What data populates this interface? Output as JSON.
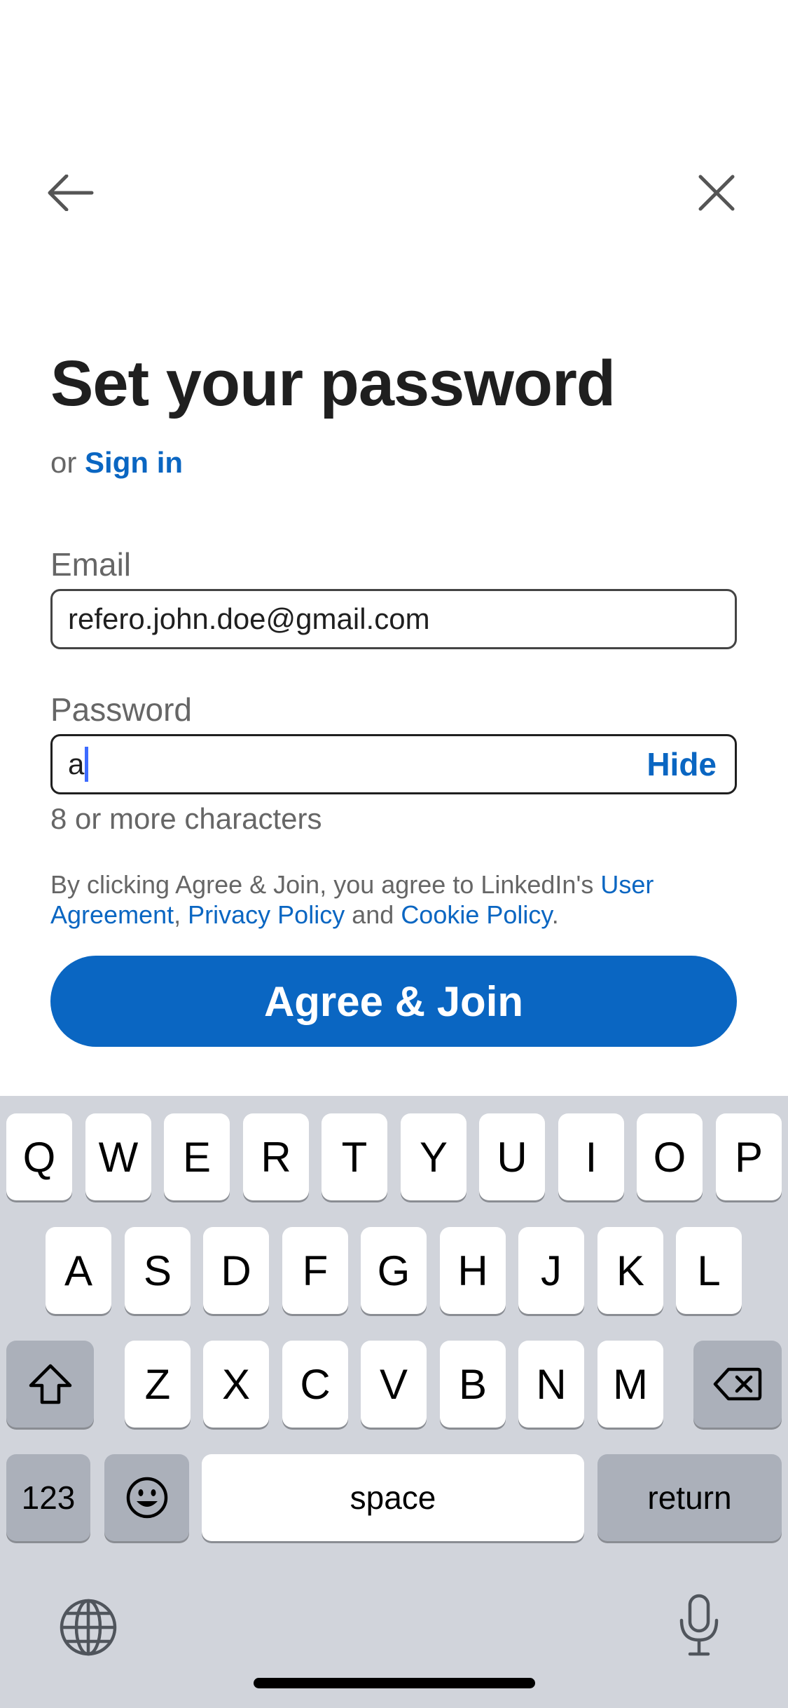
{
  "header": {
    "back_icon": "arrow-left-icon",
    "close_icon": "close-icon"
  },
  "title": "Set your password",
  "signin": {
    "prefix": "or",
    "link": "Sign in"
  },
  "email": {
    "label": "Email",
    "value": "refero.john.doe@gmail.com"
  },
  "password": {
    "label": "Password",
    "value": "a",
    "toggle": "Hide",
    "hint": "8 or more characters"
  },
  "legal": {
    "text1": "By clicking Agree & Join, you agree to LinkedIn's",
    "user_agreement": "User Agreement",
    "comma": ",",
    "privacy_policy": "Privacy Policy",
    "and": "and",
    "cookie_policy": "Cookie Policy",
    "period": "."
  },
  "cta": {
    "label": "Agree & Join"
  },
  "keyboard": {
    "row1": [
      "Q",
      "W",
      "E",
      "R",
      "T",
      "Y",
      "U",
      "I",
      "O",
      "P"
    ],
    "row2": [
      "A",
      "S",
      "D",
      "F",
      "G",
      "H",
      "J",
      "K",
      "L"
    ],
    "row3": [
      "Z",
      "X",
      "C",
      "V",
      "B",
      "N",
      "M"
    ],
    "numbers": "123",
    "space": "space",
    "return": "return"
  },
  "colors": {
    "brand": "#0a66c2",
    "keyboard_bg": "#d1d4db",
    "key_dark": "#abb0ba"
  }
}
